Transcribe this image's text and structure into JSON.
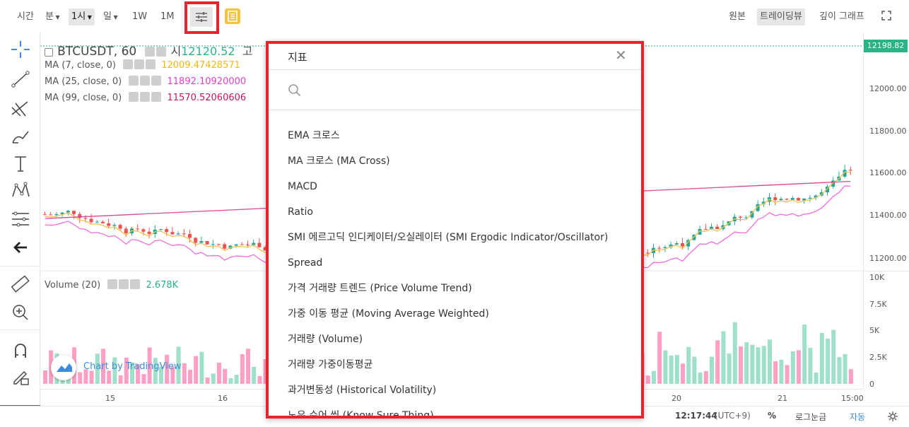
{
  "toolbar": {
    "time_label": "시간",
    "minute_label": "분",
    "interval_selected": "1시",
    "day_label": "일",
    "week_label": "1W",
    "month_label": "1M",
    "original_label": "원본",
    "tradingview_label": "트레이딩뷰",
    "depth_label": "깊이 그래프"
  },
  "legend": {
    "symbol": "BTCUSDT, 60",
    "open_prefix": "시",
    "open_value": "12120.52",
    "open_suffix": "고",
    "ma7_label": "MA (7, close, 0)",
    "ma7_value": "12009.47428571",
    "ma25_label": "MA (25, close, 0)",
    "ma25_value": "11892.10920000",
    "ma99_label": "MA (99, close, 0)",
    "ma99_value": "11570.52060606",
    "volume_label": "Volume (20)",
    "volume_value": "2.678K"
  },
  "price_axis": {
    "current_price": "12198.82",
    "labels": [
      "12000.00",
      "11800.00",
      "11600.00",
      "11400.00",
      "11200.00"
    ],
    "volume_labels": [
      "10K",
      "7.5K",
      "5K",
      "2.5K",
      "0"
    ]
  },
  "time_axis": {
    "labels": [
      "15",
      "16",
      "20",
      "21",
      "15:00"
    ]
  },
  "watermark": {
    "text": "Chart by TradingView"
  },
  "bottom": {
    "clock": "12:17:44",
    "tz": "(UTC+9)",
    "percent": "%",
    "log": "로그눈금",
    "auto": "자동"
  },
  "dialog": {
    "title": "지표",
    "close": "✕",
    "search_placeholder": "",
    "items": [
      "EMA 크로스",
      "MA 크로스 (MA Cross)",
      "MACD",
      "Ratio",
      "SMI 에르고딕 인디케이터/오실레이터 (SMI Ergodic Indicator/Oscillator)",
      "Spread",
      "가격 거래량 트렌드 (Price Volume Trend)",
      "가중 이동 평균 (Moving Average Weighted)",
      "거래량 (Volume)",
      "거래량 가중이동평균",
      "과거변동성 (Historical Volatility)",
      "노우 슈어 씽 (Know Sure Thing)"
    ]
  },
  "colors": {
    "up": "#26a69a",
    "down": "#ef5350",
    "ma7": "#f5c04a",
    "ma25": "#f06bdc",
    "ma99": "#d9478f",
    "highlight": "#e8232d"
  }
}
